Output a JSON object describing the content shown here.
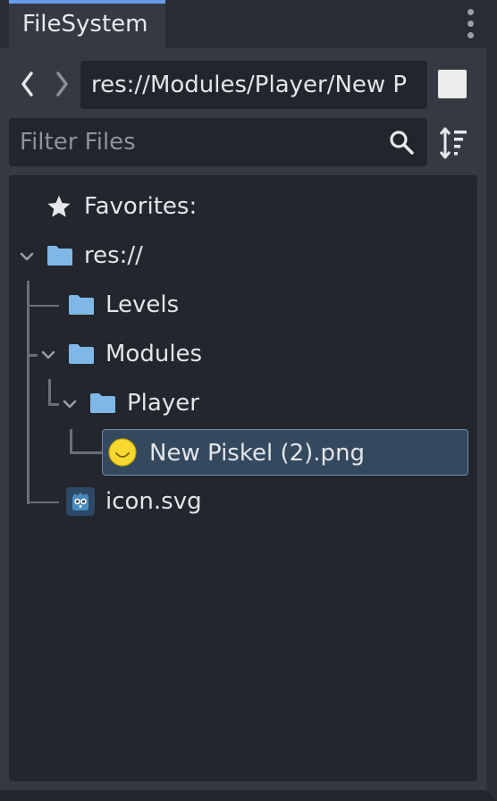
{
  "panel": {
    "tab_label": "FileSystem",
    "menu_icon": "kebab-menu-icon"
  },
  "navigation": {
    "back_icon": "chevron-left-icon",
    "forward_icon": "chevron-right-icon",
    "path": "res://Modules/Player/New P",
    "layout_icon": "split-mode-icon"
  },
  "filter": {
    "placeholder": "Filter Files",
    "value": "",
    "search_icon": "search-icon",
    "sort_icon": "sort-icon"
  },
  "tree": {
    "favorites_label": "Favorites:",
    "root_label": "res://",
    "levels_label": "Levels",
    "modules_label": "Modules",
    "player_label": "Player",
    "selected_file_label": "New Piskel (2).png",
    "icon_file_label": "icon.svg"
  },
  "colors": {
    "accent": "#699ce8",
    "folder": "#7fb8e6",
    "selection": "#34495e"
  }
}
